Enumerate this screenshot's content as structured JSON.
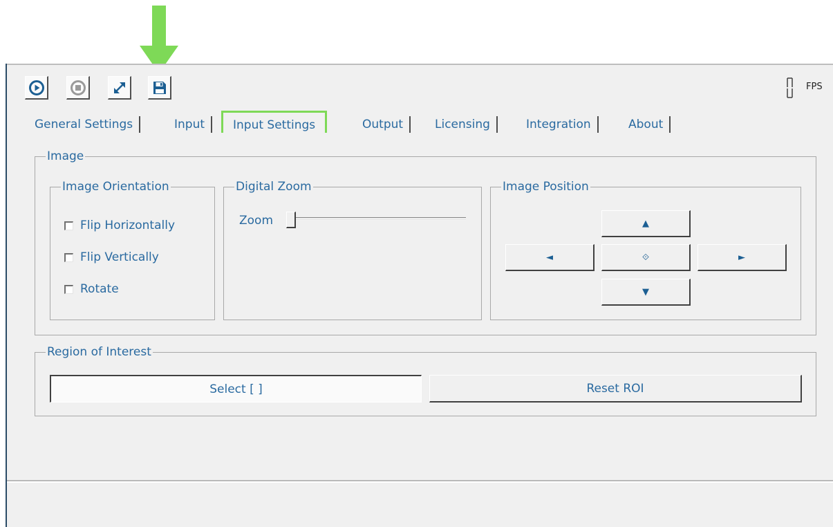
{
  "annotation": {
    "arrow_color": "#7ed957",
    "highlight_color": "#7ed957"
  },
  "toolbar": {
    "buttons": [
      {
        "name": "play",
        "icon": "play-circle-icon"
      },
      {
        "name": "stop",
        "icon": "stop-circle-icon"
      },
      {
        "name": "fullscreen",
        "icon": "expand-arrows-icon"
      },
      {
        "name": "save",
        "icon": "floppy-disk-icon"
      }
    ],
    "fps_label": "FPS"
  },
  "tabs": [
    {
      "label": "General Settings"
    },
    {
      "label": "Input"
    },
    {
      "label": "Input Settings",
      "active": true
    },
    {
      "label": "Output"
    },
    {
      "label": "Licensing"
    },
    {
      "label": "Integration"
    },
    {
      "label": "About"
    }
  ],
  "image_group": {
    "title": "Image",
    "orientation": {
      "title": "Image Orientation",
      "options": [
        {
          "label": "Flip Horizontally",
          "checked": false
        },
        {
          "label": "Flip Vertically",
          "checked": false
        },
        {
          "label": "Rotate",
          "checked": false
        }
      ]
    },
    "zoom": {
      "title": "Digital Zoom",
      "label": "Zoom",
      "value": 0
    },
    "position": {
      "title": "Image Position",
      "up": "▲",
      "left": "◄",
      "center": "⟐",
      "right": "►",
      "down": "▼"
    }
  },
  "roi_group": {
    "title": "Region of Interest",
    "select_label": "Select [ ]",
    "reset_label": "Reset ROI"
  }
}
